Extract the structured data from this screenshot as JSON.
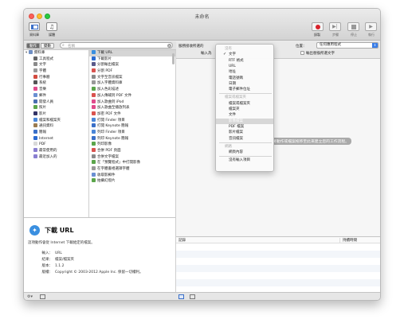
{
  "window": {
    "title": "未命名"
  },
  "toolbar": {
    "library_label": "資料庫",
    "media_label": "媒體",
    "record_label": "錄製",
    "step_label": "步驟",
    "stop_label": "停止",
    "run_label": "執行"
  },
  "filter": {
    "actions_label": "動作",
    "variables_label": "變數",
    "search_placeholder": "名稱"
  },
  "library": {
    "items": [
      {
        "label": "資料庫",
        "icon": "folder-icon",
        "color": "#6f8fc4",
        "selected": false
      },
      {
        "label": "工具程式",
        "icon": "tools-icon",
        "color": "#666666"
      },
      {
        "label": "文字",
        "icon": "text-icon",
        "color": "#8a8a8a"
      },
      {
        "label": "字體",
        "icon": "font-icon",
        "color": "#999999"
      },
      {
        "label": "行事曆",
        "icon": "calendar-icon",
        "color": "#d34a3f"
      },
      {
        "label": "系統",
        "icon": "system-icon",
        "color": "#555555"
      },
      {
        "label": "音樂",
        "icon": "music-icon",
        "color": "#e04b8c"
      },
      {
        "label": "郵件",
        "icon": "mail-icon",
        "color": "#6a8fd2"
      },
      {
        "label": "開發人員",
        "icon": "developer-icon",
        "color": "#4a6fb0"
      },
      {
        "label": "照片",
        "icon": "photos-icon",
        "color": "#5ba54b"
      },
      {
        "label": "影片",
        "icon": "movie-icon",
        "color": "#333366"
      },
      {
        "label": "檔案和檔案夾",
        "icon": "finder-icon",
        "color": "#4a86d8"
      },
      {
        "label": "通訊資料",
        "icon": "contacts-icon",
        "color": "#9b7b4f"
      },
      {
        "label": "簡報",
        "icon": "presentation-icon",
        "color": "#3a6fc8"
      },
      {
        "label": "Internet",
        "icon": "globe-icon",
        "color": "#2b6bd1"
      },
      {
        "label": "PDF",
        "icon": "pdf-icon",
        "color": "#d9d9d9"
      },
      {
        "label": "最常使用的",
        "icon": "smart-folder-icon",
        "color": "#8a7fd1"
      },
      {
        "label": "最近加入的",
        "icon": "smart-folder-icon",
        "color": "#8a7fd1"
      }
    ]
  },
  "actions": {
    "items": [
      {
        "label": "下載 URL",
        "color": "#3a8fe0",
        "selected": true
      },
      {
        "label": "下載影片",
        "color": "#2b6bd1"
      },
      {
        "label": "分割輸出檔案",
        "color": "#5a5a8a"
      },
      {
        "label": "分割 PDF",
        "color": "#d9534f"
      },
      {
        "label": "文字至音訊檔案",
        "color": "#8a8a8a"
      },
      {
        "label": "加入字體資料庫",
        "color": "#999999"
      },
      {
        "label": "加入色彩描述",
        "color": "#5ba54b"
      },
      {
        "label": "加入傳補到 PDF 文件",
        "color": "#d9534f"
      },
      {
        "label": "加入歌曲到 iPod",
        "color": "#e04b8c"
      },
      {
        "label": "加入歌曲至播放列表",
        "color": "#e04b8c"
      },
      {
        "label": "加密 PDF 文件",
        "color": "#d9534f"
      },
      {
        "label": "打開 Finder 項目",
        "color": "#4a86d8"
      },
      {
        "label": "打開 Keynote 簡報",
        "color": "#3a6fc8"
      },
      {
        "label": "列印 Finder 項目",
        "color": "#4a86d8"
      },
      {
        "label": "列印 Keynote 簡報",
        "color": "#3a6fc8"
      },
      {
        "label": "列印影像",
        "color": "#5ba54b"
      },
      {
        "label": "合併 PDF 頁面",
        "color": "#d9534f"
      },
      {
        "label": "合併文字檔案",
        "color": "#8a8a8a"
      },
      {
        "label": "在「預覽程式」中打開影像",
        "color": "#5ba54b"
      },
      {
        "label": "在字體書裡選擇字體",
        "color": "#999999"
      },
      {
        "label": "收取影郵件",
        "color": "#6a8fd2"
      },
      {
        "label": "拍攝幻燈片",
        "color": "#5ba54b"
      }
    ]
  },
  "description": {
    "title": "下載 URL",
    "text": "這項動作會從 Internet 下載給定的檔案。",
    "input_label": "輸入：",
    "input_value": "URL",
    "result_label": "結果：",
    "result_value": "檔案/檔案夾",
    "version_label": "版本：",
    "version_value": "1.1.2",
    "copyright_label": "版權：",
    "copyright_value": "Copyright © 2003-2012 Apple Inc. 保留一切權利。"
  },
  "workflow": {
    "receives_label": "服務接收所選的",
    "input_is_label": "輸入為",
    "location_label": "位置：",
    "location_value": "任何應用程式",
    "replace_label": "輸出替換所選文字",
    "hint": "將動作或檔案拖移至此來建立您的工作流程。"
  },
  "log": {
    "col_log": "記錄",
    "col_duration": "持續時間"
  },
  "menu": {
    "items": [
      {
        "label": "沒有",
        "type": "header"
      },
      {
        "label": "文字",
        "type": "checked"
      },
      {
        "label": "RTF 格式",
        "type": "item"
      },
      {
        "label": "URL",
        "type": "item"
      },
      {
        "label": "地址",
        "type": "item"
      },
      {
        "label": "電話號碼",
        "type": "item"
      },
      {
        "label": "日期",
        "type": "item"
      },
      {
        "label": "電子郵件位址",
        "type": "item"
      },
      {
        "label": "檔案或檔案夾",
        "type": "header"
      },
      {
        "label": "檔案或檔案夾",
        "type": "item"
      },
      {
        "label": "檔案夾",
        "type": "item"
      },
      {
        "label": "文件",
        "type": "item"
      },
      {
        "label": "影像檔案",
        "type": "highlight"
      },
      {
        "label": "PDF 檔案",
        "type": "item"
      },
      {
        "label": "影片檔案",
        "type": "item"
      },
      {
        "label": "音訊檔案",
        "type": "item"
      },
      {
        "label": "網路",
        "type": "header"
      },
      {
        "label": "網頁內容",
        "type": "item"
      },
      {
        "label": "沒有輸入項目",
        "type": "item"
      }
    ]
  }
}
